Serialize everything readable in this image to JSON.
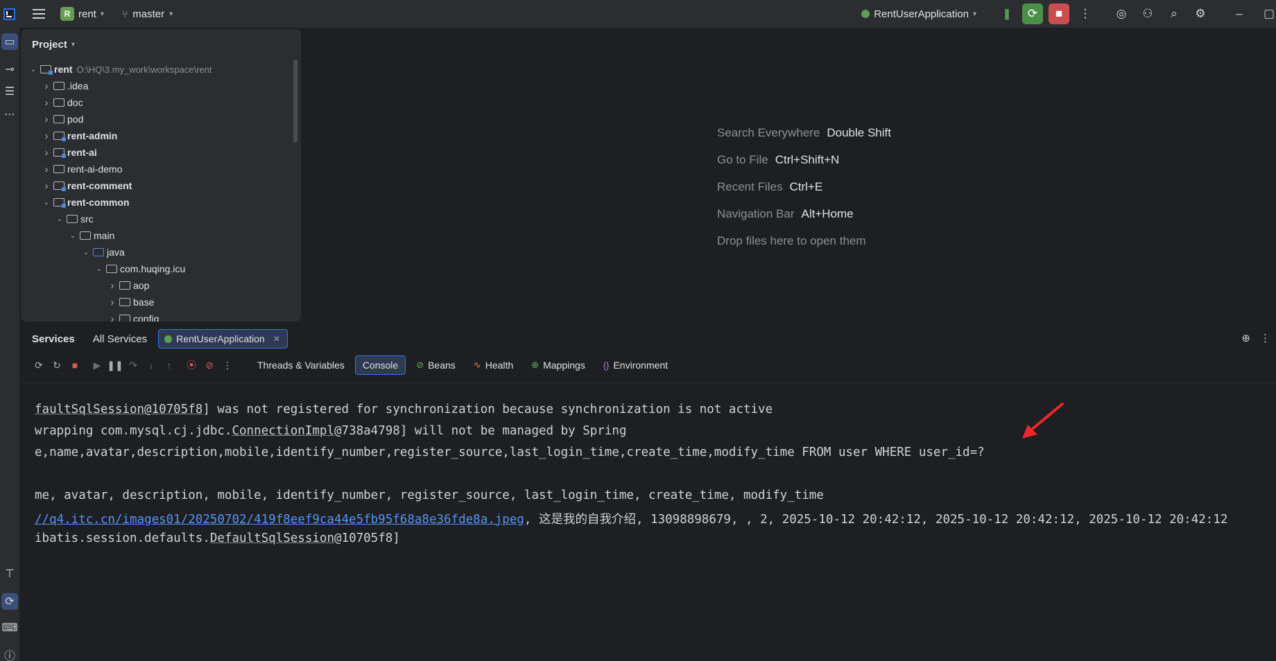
{
  "titlebar": {
    "project_badge": "R",
    "project_name": "rent",
    "branch": "master",
    "run_config": "RentUserApplication",
    "icons": [
      "app-logo",
      "hamburger-menu-icon",
      "pause-icon",
      "rerun-icon",
      "stop-icon",
      "more-icon",
      "ai-assistant-icon",
      "add-user-icon",
      "search-icon",
      "settings-icon",
      "minimize-icon"
    ]
  },
  "project_panel": {
    "title": "Project",
    "tree": [
      {
        "label": "rent",
        "path": "O:\\HQ\\3.my_work\\workspace\\rent",
        "depth": 0,
        "expanded": true,
        "bold": true,
        "type": "module"
      },
      {
        "label": ".idea",
        "depth": 1,
        "expanded": false,
        "bold": false,
        "type": "folder"
      },
      {
        "label": "doc",
        "depth": 1,
        "expanded": false,
        "bold": false,
        "type": "folder"
      },
      {
        "label": "pod",
        "depth": 1,
        "expanded": false,
        "bold": false,
        "type": "folder"
      },
      {
        "label": "rent-admin",
        "depth": 1,
        "expanded": false,
        "bold": true,
        "type": "module"
      },
      {
        "label": "rent-ai",
        "depth": 1,
        "expanded": false,
        "bold": true,
        "type": "module"
      },
      {
        "label": "rent-ai-demo",
        "depth": 1,
        "expanded": false,
        "bold": false,
        "type": "folder"
      },
      {
        "label": "rent-comment",
        "depth": 1,
        "expanded": false,
        "bold": true,
        "type": "module"
      },
      {
        "label": "rent-common",
        "depth": 1,
        "expanded": true,
        "bold": true,
        "type": "module"
      },
      {
        "label": "src",
        "depth": 2,
        "expanded": true,
        "bold": false,
        "type": "folder"
      },
      {
        "label": "main",
        "depth": 3,
        "expanded": true,
        "bold": false,
        "type": "folder"
      },
      {
        "label": "java",
        "depth": 4,
        "expanded": true,
        "bold": false,
        "type": "src"
      },
      {
        "label": "com.huqing.icu",
        "depth": 5,
        "expanded": true,
        "bold": false,
        "type": "package"
      },
      {
        "label": "aop",
        "depth": 6,
        "expanded": false,
        "bold": false,
        "type": "package"
      },
      {
        "label": "base",
        "depth": 6,
        "expanded": false,
        "bold": false,
        "type": "package"
      },
      {
        "label": "config",
        "depth": 6,
        "expanded": false,
        "bold": false,
        "type": "package"
      }
    ]
  },
  "editor": {
    "hints": [
      {
        "label": "Search Everywhere",
        "key": "Double Shift"
      },
      {
        "label": "Go to File",
        "key": "Ctrl+Shift+N"
      },
      {
        "label": "Recent Files",
        "key": "Ctrl+E"
      },
      {
        "label": "Navigation Bar",
        "key": "Alt+Home"
      },
      {
        "label": "Drop files here to open them",
        "key": ""
      }
    ]
  },
  "services": {
    "title": "Services",
    "tab_all": "All Services",
    "tab_active": "RentUserApplication",
    "sub_tabs": [
      "Threads & Variables",
      "Console",
      "Beans",
      "Health",
      "Mappings",
      "Environment"
    ],
    "active_sub_tab": "Console",
    "console": {
      "line1_a": "faultSqlSession@10705f8",
      "line1_b": "] was not registered for synchronization because synchronization is not active",
      "line2_a": "wrapping com.mysql.cj.jdbc.",
      "line2_b": "ConnectionImpl",
      "line2_c": "@738a4798] will not be managed by Spring",
      "line3": "e,name,avatar,description,mobile,identify_number,register_source,last_login_time,create_time,modify_time FROM user WHERE user_id=?",
      "line4": "me, avatar, description, mobile, identify_number, register_source, last_login_time, create_time, modify_time",
      "line5_link": "//q4.itc.cn/images01/20250702/419f8eef9ca44e5fb95f68a8e36fde8a.jpeg",
      "line5_rest": ", 这是我的自我介绍, 13098898679, , 2, 2025-10-12 20:42:12, 2025-10-12 20:42:12, 2025-10-12 20:42:12",
      "line6_a": "ibatis.session.defaults.",
      "line6_b": "DefaultSqlSession",
      "line6_c": "@10705f8]"
    }
  },
  "colors": {
    "accent": "#3574f0",
    "run_green": "#4c8f49",
    "stop_red": "#c94f4f",
    "annotation_arrow": "#e8282b"
  }
}
